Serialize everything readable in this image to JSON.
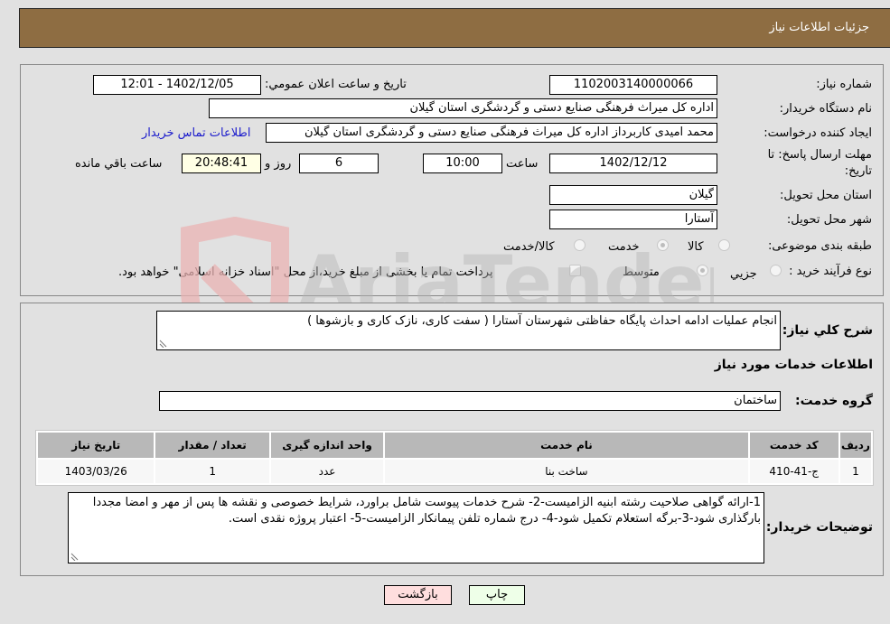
{
  "header": {
    "title": "جزئیات اطلاعات نیاز"
  },
  "form": {
    "need_number": {
      "label": "شماره نیاز:",
      "value": "1102003140000066"
    },
    "announce_datetime": {
      "label": "تاریخ و ساعت اعلان عمومي:",
      "value": "1402/12/05 - 12:01"
    },
    "buyer_org": {
      "label": "نام دستگاه خریدار:",
      "value": "اداره کل میراث فرهنگی  صنایع دستی و گردشگری استان گیلان"
    },
    "requester": {
      "label": "ایجاد کننده درخواست:",
      "value": "محمد امیدی کاربرداز اداره کل میراث فرهنگی  صنایع دستی و گردشگری استان گیلان",
      "contact_link": "اطلاعات تماس خریدار"
    },
    "deadline": {
      "label_line1": "مهلت ارسال پاسخ: تا",
      "label_line2": "تاریخ:",
      "date": "1402/12/12",
      "time_label": "ساعت",
      "time": "10:00",
      "days": "6",
      "days_label": "روز و",
      "remaining": "20:48:41",
      "remaining_label": "ساعت باقي مانده"
    },
    "province": {
      "label": "استان محل تحویل:",
      "value": "گیلان"
    },
    "city": {
      "label": "شهر محل تحویل:",
      "value": "آستارا"
    },
    "category": {
      "label": "طبقه بندی موضوعی:",
      "options": [
        "کالا",
        "خدمت",
        "کالا/خدمت"
      ],
      "selected": "خدمت"
    },
    "purchase_type": {
      "label": "نوع فرآیند خرید :",
      "options": [
        "جزيي",
        "متوسط"
      ],
      "selected": "متوسط",
      "treasury_note": "پرداخت تمام یا بخشی از مبلغ خرید،از محل \"اسناد خزانه اسلامی\" خواهد بود."
    }
  },
  "details": {
    "summary_label": "شرح كلي نياز:",
    "summary_value": "انجام عملیات ادامه احداث پایگاه حفاظتی شهرستان آستارا ( سفت کاری، نازک کاری و بازشوها )",
    "services_heading": "اطلاعات خدمات مورد نیاز",
    "service_group_label": "گروه خدمت:",
    "service_group_value": "ساختمان",
    "table": {
      "headers": [
        "ردیف",
        "کد خدمت",
        "نام خدمت",
        "واحد اندازه گیری",
        "تعداد / مقدار",
        "تاریخ نیاز"
      ],
      "rows": [
        [
          "1",
          "ج-41-410",
          "ساخت بنا",
          "عدد",
          "1",
          "1403/03/26"
        ]
      ]
    },
    "buyer_notes_label": "توضیحات خریدار:",
    "buyer_notes_value": "1-ارائه گواهی صلاحیت رشته ابنیه الزامیست-2- شرح خدمات پیوست شامل براورد، شرایط خصوصی و نقشه ها پس از مهر و امضا مجددا بارگذاری شود-3-برگه استعلام تکمیل شود-4- درج شماره تلفن پیمانکار الزامیست-5- اعتبار پروژه نقدی است."
  },
  "buttons": {
    "print": "چاپ",
    "back": "بازگشت"
  },
  "watermark": {
    "text": "AriaTender.neT"
  }
}
